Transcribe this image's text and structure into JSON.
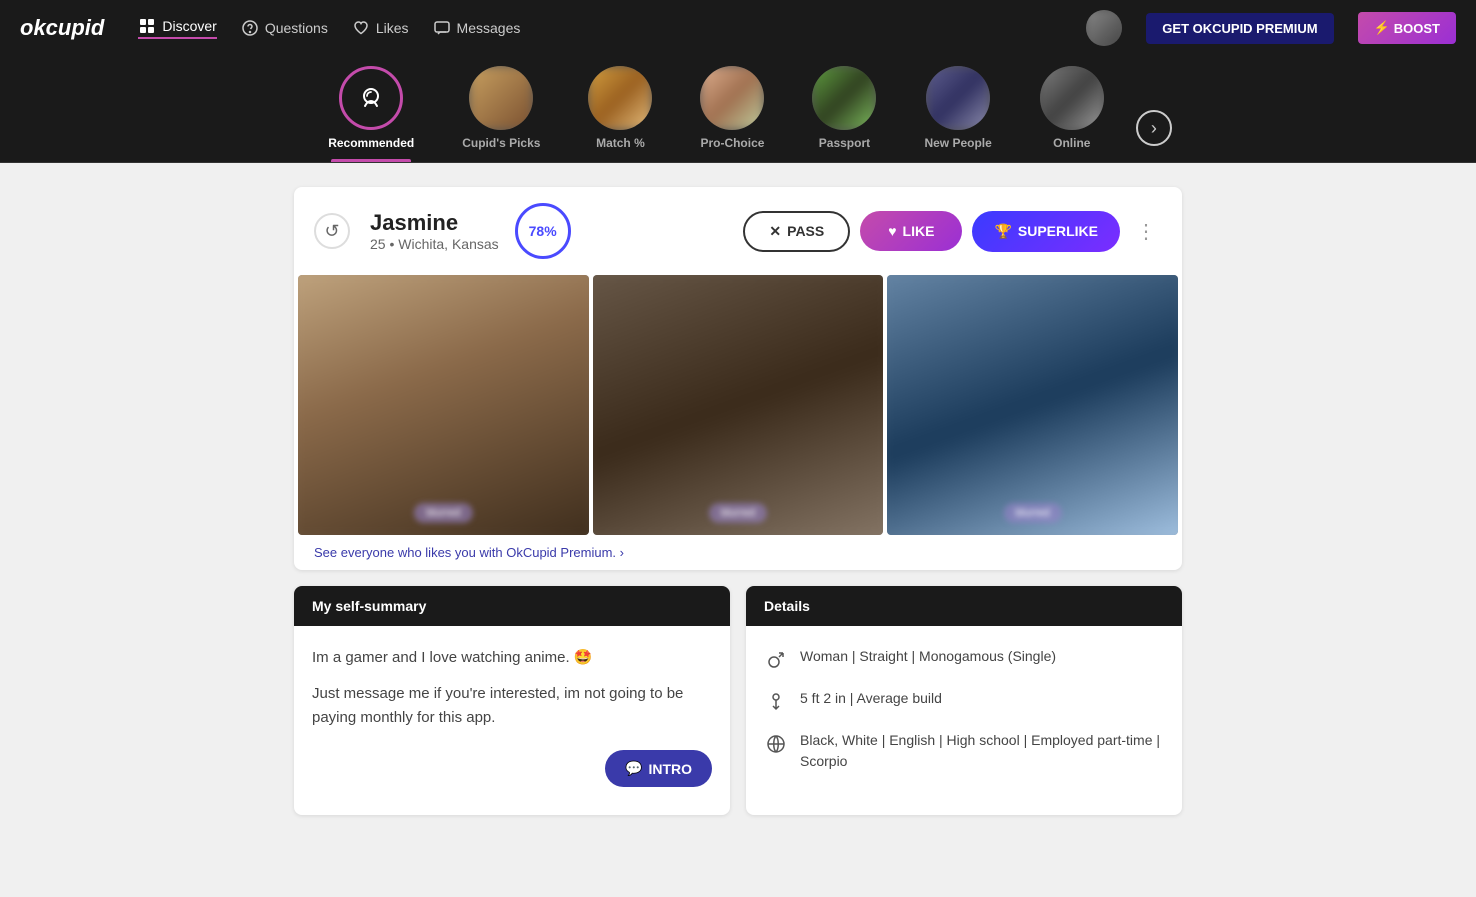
{
  "brand": {
    "name": "okcupid"
  },
  "nav": {
    "items": [
      {
        "label": "Discover",
        "icon": "grid-icon",
        "active": true
      },
      {
        "label": "Questions",
        "icon": "question-icon",
        "active": false
      },
      {
        "label": "Likes",
        "icon": "heart-icon",
        "active": false
      },
      {
        "label": "Messages",
        "icon": "message-icon",
        "active": false
      }
    ],
    "premium_btn": "GET OKCUPID PREMIUM",
    "boost_btn": "BOOST"
  },
  "discover_bar": {
    "items": [
      {
        "label": "Recommended",
        "is_icon": true,
        "active": true
      },
      {
        "label": "Cupid's Picks",
        "active": false
      },
      {
        "label": "Match %",
        "active": false
      },
      {
        "label": "Pro-Choice",
        "active": false
      },
      {
        "label": "Passport",
        "active": false
      },
      {
        "label": "New People",
        "active": false
      },
      {
        "label": "Online",
        "active": false
      }
    ]
  },
  "profile": {
    "name": "Jasmine",
    "age": "25",
    "location": "Wichita, Kansas",
    "match_percent": "78%",
    "actions": {
      "pass": "PASS",
      "like": "LIKE",
      "superlike": "SUPERLIKE"
    },
    "premium_prompt": "See everyone who likes you with OkCupid Premium. ›",
    "photos_count": 3
  },
  "self_summary": {
    "header": "My self-summary",
    "text1": "Im a gamer and I love watching anime. 🤩",
    "text2": "Just message me if you're interested, im not going to be paying monthly for this app.",
    "intro_btn": "INTRO"
  },
  "details": {
    "header": "Details",
    "items": [
      {
        "icon": "gender-icon",
        "text": "Woman | Straight | Monogamous (Single)"
      },
      {
        "icon": "height-icon",
        "text": "5 ft 2 in | Average build"
      },
      {
        "icon": "globe-icon",
        "text": "Black, White | English | High school | Employed part-time | Scorpio"
      }
    ]
  }
}
